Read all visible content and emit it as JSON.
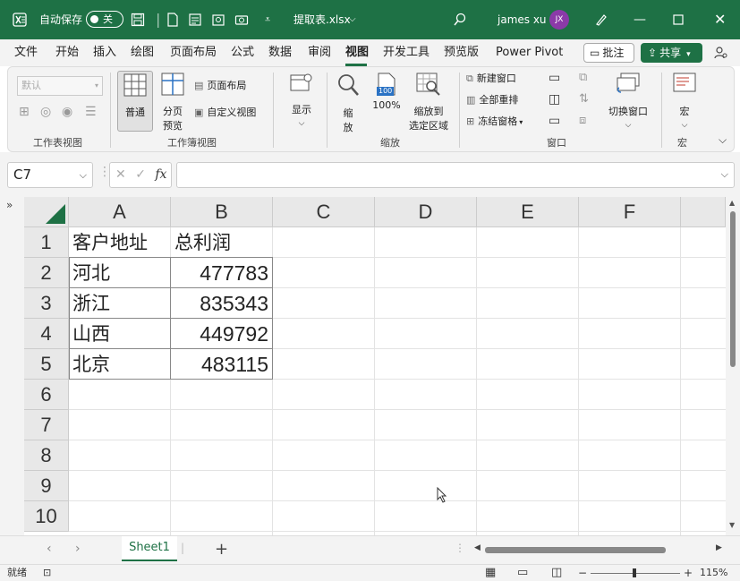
{
  "titlebar": {
    "autosave_label": "自动保存",
    "autosave_state": "关",
    "filename": "提取表.xlsx",
    "username": "james xu",
    "avatar_initials": "JX",
    "accent": "#1e7145"
  },
  "menu": {
    "items": [
      "文件",
      "开始",
      "插入",
      "绘图",
      "页面布局",
      "公式",
      "数据",
      "审阅",
      "视图",
      "开发工具",
      "预览版",
      "Power Pivot"
    ],
    "active": "视图",
    "comment_label": "批注",
    "share_label": "共享"
  },
  "ribbon": {
    "sheet_view_select": "默认",
    "group_sheet_view": "工作表视图",
    "normal_label": "普通",
    "page_break_label_1": "分页",
    "page_break_label_2": "预览",
    "page_layout_label": "页面布局",
    "custom_view_label": "自定义视图",
    "group_workbook_view": "工作簿视图",
    "show_label": "显示",
    "zoom_label_1": "缩",
    "zoom_label_2": "放",
    "zoom100_label": "100%",
    "zoom100_icon_text": "100",
    "zoom_selection_1": "缩放到",
    "zoom_selection_2": "选定区域",
    "group_zoom": "缩放",
    "new_window_label": "新建窗口",
    "arrange_all_label": "全部重排",
    "freeze_panes_label": "冻结窗格",
    "group_window": "窗口",
    "switch_window_label": "切换窗口",
    "macros_label": "宏",
    "group_macros": "宏"
  },
  "formula_bar": {
    "name_box": "C7",
    "fx_label": "fx",
    "formula": ""
  },
  "grid": {
    "columns": [
      "A",
      "B",
      "C",
      "D",
      "E",
      "F"
    ],
    "rows": [
      "1",
      "2",
      "3",
      "4",
      "5",
      "6",
      "7",
      "8",
      "9",
      "10"
    ],
    "headers": [
      "客户地址",
      "总利润"
    ],
    "data": [
      [
        "河北",
        "477783"
      ],
      [
        "浙江",
        "835343"
      ],
      [
        "山西",
        "449792"
      ],
      [
        "北京",
        "483115"
      ]
    ]
  },
  "sheets": {
    "tabs": [
      "Sheet1"
    ],
    "add_label": "+"
  },
  "status": {
    "ready": "就绪",
    "zoom": "115%"
  }
}
